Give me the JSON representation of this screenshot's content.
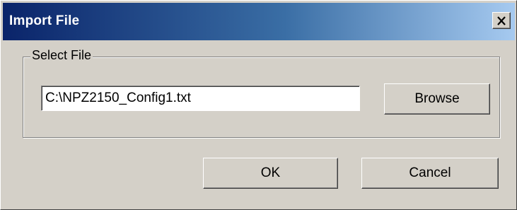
{
  "window": {
    "title": "Import File",
    "close_glyph": "×"
  },
  "group": {
    "label": "Select File",
    "file_path": "C:\\NPZ2150_Config1.txt",
    "browse_label": "Browse"
  },
  "buttons": {
    "ok_label": "OK",
    "cancel_label": "Cancel"
  },
  "colors": {
    "titlebar_start": "#0a246a",
    "titlebar_end": "#a6caf0",
    "face": "#d4d0c8"
  },
  "icons": {
    "close": "close-icon"
  }
}
